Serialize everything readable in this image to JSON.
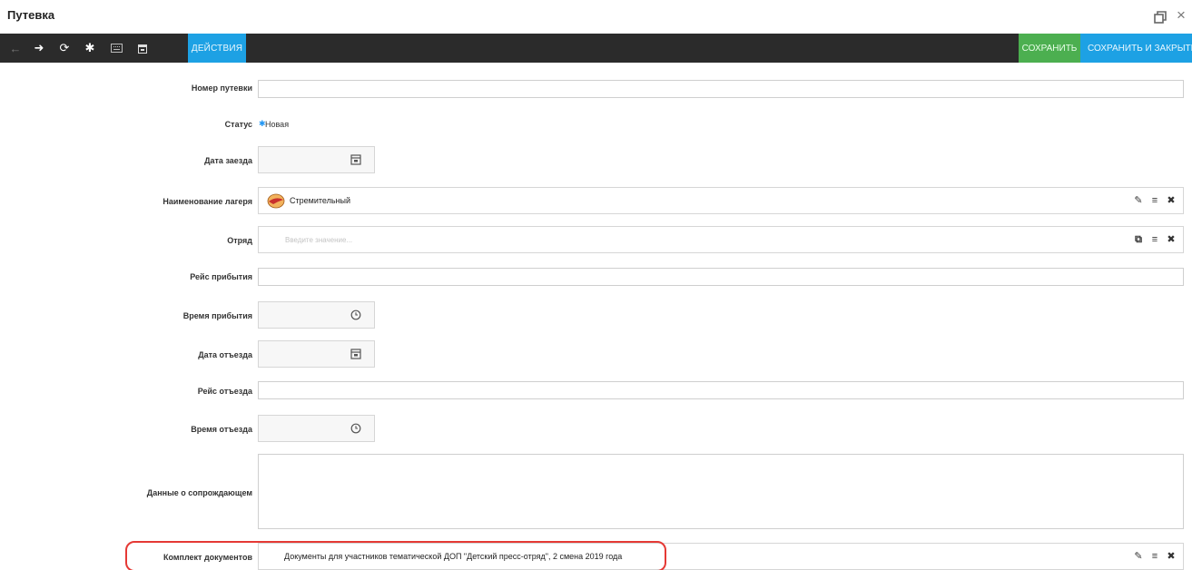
{
  "window": {
    "title": "Путевка"
  },
  "toolbar": {
    "actions_label": "ДЕЙСТВИЯ",
    "save_label": "СОХРАНИТЬ",
    "save_close_label": "СОХРАНИТЬ И ЗАКРЫТЬ",
    "icons": [
      "arrow-left-icon",
      "arrow-right-icon",
      "refresh-icon",
      "gear-icon",
      "keyboard-icon",
      "calendar-icon"
    ]
  },
  "form": {
    "trip_number_label": "Номер путевки",
    "trip_number_value": "",
    "status_label": "Статус",
    "status_value": "Новая",
    "arrival_date_label": "Дата заезда",
    "arrival_date_value": "",
    "camp_label": "Наименование лагеря",
    "camp_value": "Стремительный",
    "squad_label": "Отряд",
    "squad_placeholder": "Введите значение...",
    "arrival_flight_label": "Рейс прибытия",
    "arrival_flight_value": "",
    "arrival_time_label": "Время прибытия",
    "arrival_time_value": "",
    "departure_date_label": "Дата отъезда",
    "departure_date_value": "",
    "departure_flight_label": "Рейс отъезда",
    "departure_flight_value": "",
    "departure_time_label": "Время отъезда",
    "departure_time_value": "",
    "escort_label": "Данные о сопрождающем",
    "escort_value": "",
    "documents_label": "Комплект документов",
    "documents_value": "Документы для участников тематической ДОП \"Детский пресс-отряд\", 2 смена 2019 года"
  },
  "colors": {
    "toolbar_bg": "#2b2b2b",
    "accent_blue": "#1da1e4",
    "save_green": "#4caf50",
    "highlight_red": "#e53935"
  }
}
